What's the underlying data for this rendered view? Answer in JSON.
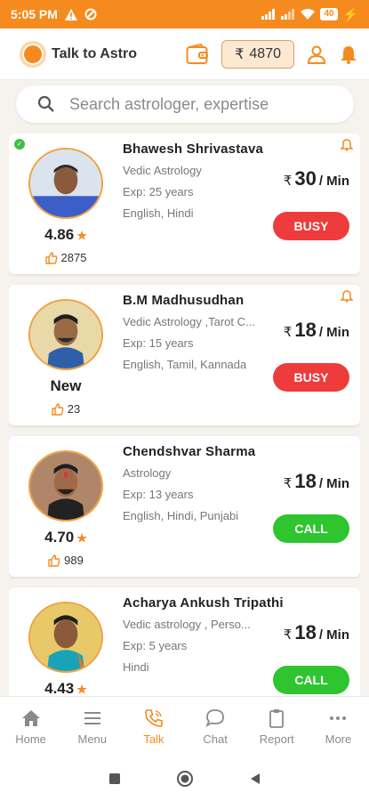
{
  "status_bar": {
    "time": "5:05 PM",
    "battery": "40"
  },
  "app": {
    "title": "Talk to Astro",
    "balance_currency": "₹",
    "balance": "4870"
  },
  "search": {
    "placeholder": "Search astrologer, expertise"
  },
  "colors": {
    "brand": "#f58b1f",
    "busy": "#ee3b3b",
    "call": "#2ec52e"
  },
  "astrologers": [
    {
      "name": "Bhawesh Shrivastava",
      "expertise": "Vedic Astrology",
      "experience": "Exp: 25 years",
      "languages": "English, Hindi",
      "rating": "4.86",
      "likes": "2875",
      "currency": "₹",
      "price": "30",
      "per": "/ Min",
      "action": "BUSY",
      "status": "busy"
    },
    {
      "name": "B.M Madhusudhan",
      "expertise": "Vedic Astrology ,Tarot C...",
      "experience": "Exp: 15 years",
      "languages": "English, Tamil, Kannada",
      "rating": "New",
      "likes": "23",
      "currency": "₹",
      "price": "18",
      "per": "/ Min",
      "action": "BUSY",
      "status": "busy"
    },
    {
      "name": "Chendshvar Sharma",
      "expertise": "Astrology",
      "experience": "Exp: 13 years",
      "languages": "English, Hindi, Punjabi",
      "rating": "4.70",
      "likes": "989",
      "currency": "₹",
      "price": "18",
      "per": "/ Min",
      "action": "CALL",
      "status": "online"
    },
    {
      "name": "Acharya Ankush Tripathi",
      "expertise": "Vedic astrology , Perso...",
      "experience": "Exp: 5 years",
      "languages": "Hindi",
      "rating": "4.43",
      "likes": "",
      "currency": "₹",
      "price": "18",
      "per": "/ Min",
      "action": "CALL",
      "status": "online"
    }
  ],
  "bottom_nav": [
    {
      "label": "Home",
      "icon": "home-icon"
    },
    {
      "label": "Menu",
      "icon": "menu-icon"
    },
    {
      "label": "Talk",
      "icon": "phone-icon",
      "active": true
    },
    {
      "label": "Chat",
      "icon": "chat-icon"
    },
    {
      "label": "Report",
      "icon": "report-icon"
    },
    {
      "label": "More",
      "icon": "more-icon"
    }
  ]
}
